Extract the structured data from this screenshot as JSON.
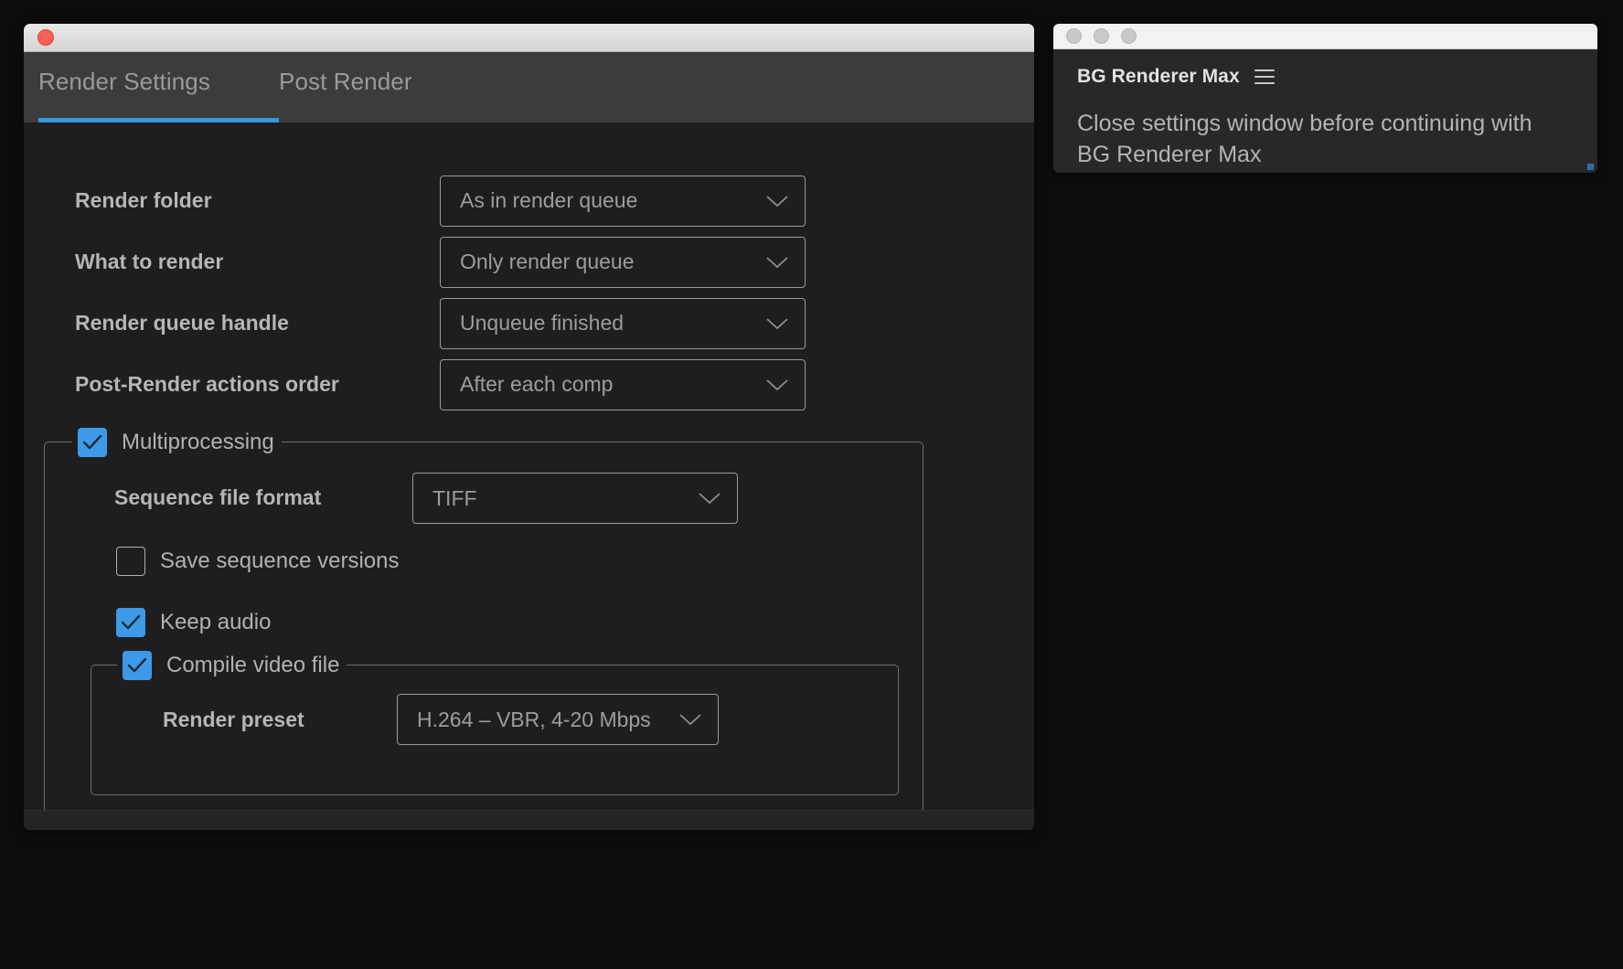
{
  "settings_window": {
    "titlebar": {
      "close_button": "close-circle"
    },
    "tabs": [
      {
        "id": "render-settings",
        "label": "Render Settings",
        "active": true
      },
      {
        "id": "post-render",
        "label": "Post Render",
        "active": false
      }
    ],
    "accent_color": "#3399e0",
    "checkbox_color": "#3d9ae8",
    "fields": [
      {
        "label": "Render folder",
        "value": "As in render queue"
      },
      {
        "label": "What to render",
        "value": "Only render queue"
      },
      {
        "label": "Render queue handle",
        "value": "Unqueue finished"
      },
      {
        "label": "Post-Render actions order",
        "value": "After each comp"
      }
    ],
    "multiprocessing": {
      "label": "Multiprocessing",
      "checked": true,
      "sequence_format": {
        "label": "Sequence file format",
        "value": "TIFF"
      },
      "save_sequence_versions": {
        "label": "Save sequence versions",
        "checked": false
      },
      "keep_audio": {
        "label": "Keep audio",
        "checked": true
      },
      "compile_video_file": {
        "label": "Compile video file",
        "checked": true,
        "render_preset": {
          "label": "Render preset",
          "value": "H.264 – VBR, 4-20 Mbps"
        }
      }
    }
  },
  "bg_renderer_window": {
    "title": "BG Renderer Max",
    "menu_icon": "hamburger-icon",
    "message": "Close settings window before continuing with BG Renderer Max",
    "traffic_lights": [
      "close",
      "minimize",
      "maximize"
    ]
  }
}
